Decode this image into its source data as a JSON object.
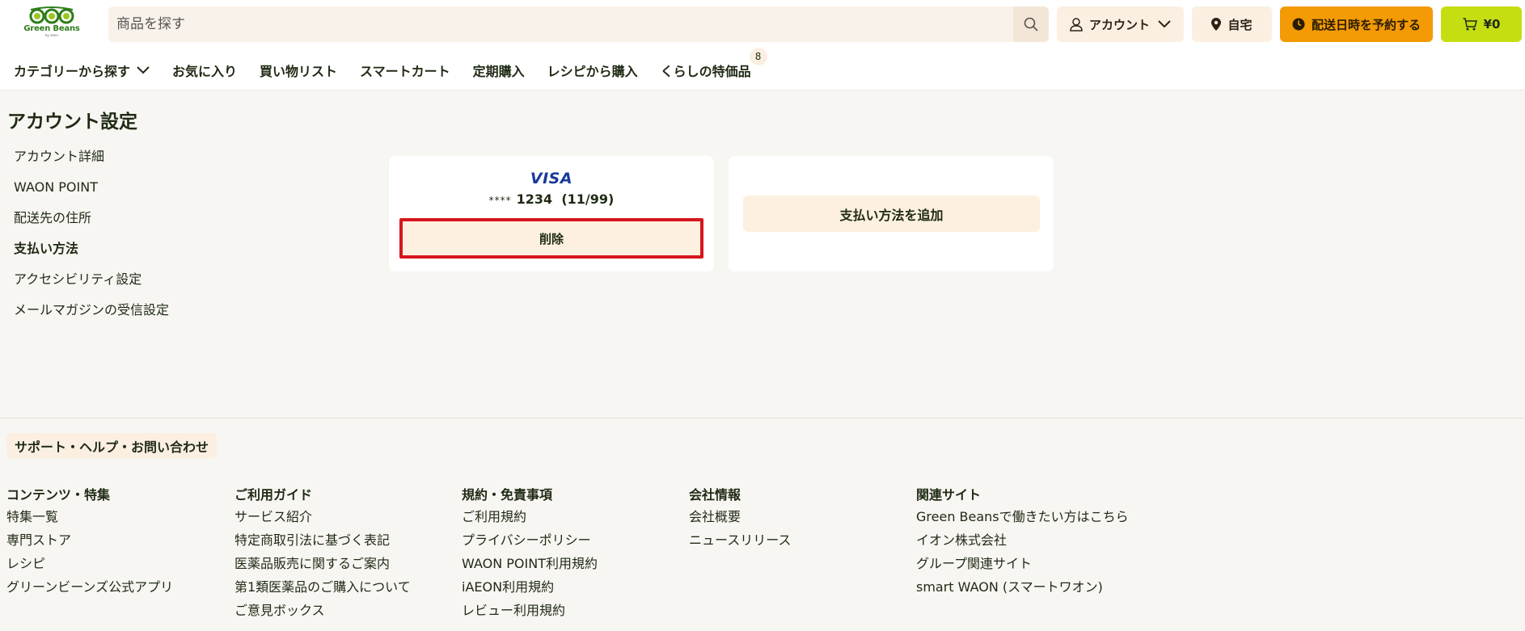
{
  "logo": {
    "text": "Green Beans",
    "sub": "by aeon",
    "icon": "pea-pod-logo"
  },
  "search": {
    "placeholder": "商品を探す",
    "icon": "search-icon"
  },
  "header": {
    "account_label": "アカウント",
    "home_label": "自宅",
    "delivery_label": "配送日時を予約する",
    "cart_label": "¥0"
  },
  "nav": {
    "items": [
      {
        "label": "カテゴリーから探す"
      },
      {
        "label": "お気に入り"
      },
      {
        "label": "買い物リスト"
      },
      {
        "label": "スマートカート"
      },
      {
        "label": "定期購入"
      },
      {
        "label": "レシピから購入"
      },
      {
        "label": "くらしの特価品",
        "badge": "8"
      }
    ]
  },
  "page": {
    "title": "アカウント設定"
  },
  "sidebar": {
    "items": [
      {
        "label": "アカウント詳細"
      },
      {
        "label": "WAON POINT"
      },
      {
        "label": "配送先の住所"
      },
      {
        "label": "支払い方法",
        "active": true
      },
      {
        "label": "アクセシビリティ設定"
      },
      {
        "label": "メールマガジンの受信設定"
      }
    ]
  },
  "payment": {
    "brand": "VISA",
    "mask": "****",
    "last4": "1234",
    "expiry": "(11/99)",
    "delete_label": "削除",
    "add_label": "支払い方法を追加"
  },
  "footer": {
    "support_label": "サポート・ヘルプ・お問い合わせ",
    "columns": [
      {
        "title": "コンテンツ・特集",
        "links": [
          "特集一覧",
          "専門ストア",
          "レシピ",
          "グリーンビーンズ公式アプリ"
        ]
      },
      {
        "title": "ご利用ガイド",
        "links": [
          "サービス紹介",
          "特定商取引法に基づく表記",
          "医薬品販売に関するご案内",
          "第1類医薬品のご購入について",
          "ご意見ボックス"
        ]
      },
      {
        "title": "規約・免責事項",
        "links": [
          "ご利用規約",
          "プライバシーポリシー",
          "WAON POINT利用規約",
          "iAEON利用規約",
          "レビュー利用規約"
        ]
      },
      {
        "title": "会社情報",
        "links": [
          "会社概要",
          "ニュースリリース"
        ]
      },
      {
        "title": "関連サイト",
        "links": [
          "Green Beansで働きたい方はこちら",
          "イオン株式会社",
          "グループ関連サイト",
          "smart WAON (スマートワオン)"
        ]
      }
    ]
  },
  "colors": {
    "brand_green": "#2e7d18",
    "delivery_orange": "#f39a04",
    "cart_lime": "#c5de11",
    "highlight_red": "#d6161e",
    "soft_beige": "#fbefe2"
  }
}
